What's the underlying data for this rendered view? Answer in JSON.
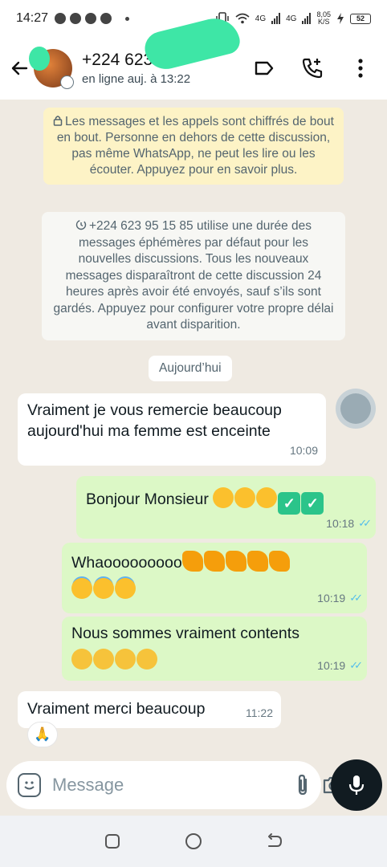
{
  "status_bar": {
    "time": "14:27",
    "network_1": "4G",
    "network_2": "4G",
    "speed": "8,05",
    "speed_unit": "K/S",
    "battery": "52"
  },
  "header": {
    "contact_name": "+224 623",
    "contact_status": "en ligne auj. à 13:22"
  },
  "chat": {
    "encryption_notice": "Les messages et les appels sont chiffrés de bout en bout. Personne en dehors de cette discussion, pas même WhatsApp, ne peut les lire ou les écouter. Appuyez pour en savoir plus.",
    "ephemeral_notice": "+224 623 95 15 85 utilise une durée des messages éphémères par défaut pour les nouvelles discussions. Tous les nouveaux messages disparaîtront de cette discussion 24 heures après avoir été envoyés, sauf s’ils sont gardés. Appuyez pour configurer votre propre délai avant disparition.",
    "date_label": "Aujourd’hui",
    "messages": [
      {
        "direction": "in",
        "text": "Vraiment je vous remercie beaucoup aujourd'hui ma femme est enceinte",
        "time": "10:09"
      },
      {
        "direction": "out",
        "text": "Bonjour Monsieur",
        "time": "10:18",
        "read": true
      },
      {
        "direction": "out",
        "text": "Whaooooooooo",
        "time": "10:19",
        "read": true
      },
      {
        "direction": "out",
        "text": "Nous sommes vraiment contents",
        "time": "10:19",
        "read": true
      },
      {
        "direction": "in",
        "text": "Vraiment merci beaucoup",
        "time": "11:22",
        "reaction": "🙏"
      }
    ]
  },
  "composer": {
    "placeholder": "Message"
  },
  "colors": {
    "incoming_bubble": "#ffffff",
    "outgoing_bubble": "#dcf8c6",
    "chat_background": "#efeae2",
    "read_ticks": "#53bdeb",
    "encryption_banner": "#fdf3c6"
  },
  "icons": [
    "back-arrow-icon",
    "label-icon",
    "add-call-icon",
    "more-vert-icon",
    "lock-icon",
    "timer-icon",
    "sticker-icon",
    "attach-icon",
    "camera-icon",
    "mic-icon",
    "recent-apps-icon",
    "home-icon",
    "back-nav-icon"
  ]
}
